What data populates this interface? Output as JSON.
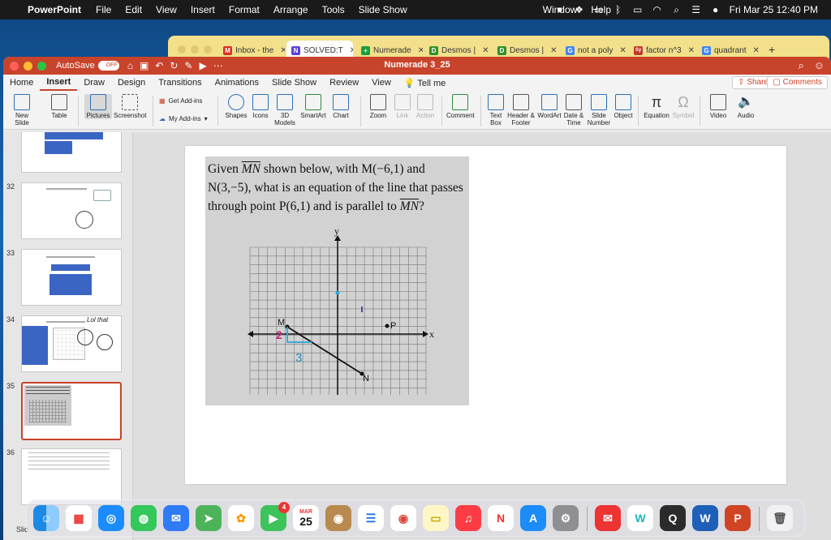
{
  "menubar": {
    "app_name": "PowerPoint",
    "items": [
      "File",
      "Edit",
      "View",
      "Insert",
      "Format",
      "Arrange",
      "Tools",
      "Slide Show"
    ],
    "window_label": "Window",
    "help_label": "Help",
    "datetime": "Fri Mar 25  12:40 PM"
  },
  "browser": {
    "tabs": [
      {
        "title": "Inbox - the",
        "favicon": "M",
        "color": "#d93025"
      },
      {
        "title": "SOLVED:T",
        "favicon": "N",
        "color": "#5b3fd6"
      },
      {
        "title": "Numerade",
        "favicon": "+",
        "color": "#1a9e3f"
      },
      {
        "title": "Desmos |",
        "favicon": "D",
        "color": "#2f8f2f"
      },
      {
        "title": "Desmos |",
        "favicon": "D",
        "color": "#2f8f2f"
      },
      {
        "title": "not a poly",
        "favicon": "G",
        "color": "#4285f4"
      },
      {
        "title": "factor n^3",
        "favicon": "Sy",
        "color": "#c0392b"
      },
      {
        "title": "quadrant",
        "favicon": "G",
        "color": "#4285f4"
      }
    ]
  },
  "window": {
    "title": "Numerade 3_25",
    "autosave_label": "AutoSave",
    "autosave_state": "OFF"
  },
  "ribbon_tabs": [
    "Home",
    "Insert",
    "Draw",
    "Design",
    "Transitions",
    "Animations",
    "Slide Show",
    "Review",
    "View"
  ],
  "tell_me": "Tell me",
  "share_label": "Share",
  "comments_label": "Comments",
  "ribbon": {
    "new_slide": "New Slide",
    "table": "Table",
    "pictures": "Pictures",
    "screenshot": "Screenshot",
    "get_addins": "Get Add-ins",
    "my_addins": "My Add-ins",
    "shapes": "Shapes",
    "icons": "Icons",
    "models_3d": "3D Models",
    "smartart": "SmartArt",
    "chart": "Chart",
    "zoom": "Zoom",
    "link": "Link",
    "action": "Action",
    "comment": "Comment",
    "text_box": "Text Box",
    "header_footer": "Header & Footer",
    "wordart": "WordArt",
    "date_time": "Date & Time",
    "slide_number": "Slide Number",
    "object": "Object",
    "equation": "Equation",
    "symbol": "Symbol",
    "video": "Video",
    "audio": "Audio"
  },
  "slides": [
    {
      "number": "32"
    },
    {
      "number": "33"
    },
    {
      "number": "34",
      "handwriting": "Lol that"
    },
    {
      "number": "35"
    },
    {
      "number": "36"
    }
  ],
  "slide_status": "Slic",
  "problem": {
    "line1_pre": "Given ",
    "segment": "MN",
    "line1_post": " shown below, with M(−6,1) and",
    "line2": "N(3,−5), what is an equation of the line that passes",
    "line3_pre": "through point P(6,1) and is parallel to ",
    "line3_post": "?"
  },
  "graph": {
    "x_label": "x",
    "y_label": "y",
    "point_M": "M",
    "point_N": "N",
    "point_P": "P",
    "annot_rise": "2",
    "annot_run": "3"
  },
  "dock": {
    "calendar_month": "MAR",
    "calendar_day": "25",
    "facetime_badge": "4"
  }
}
